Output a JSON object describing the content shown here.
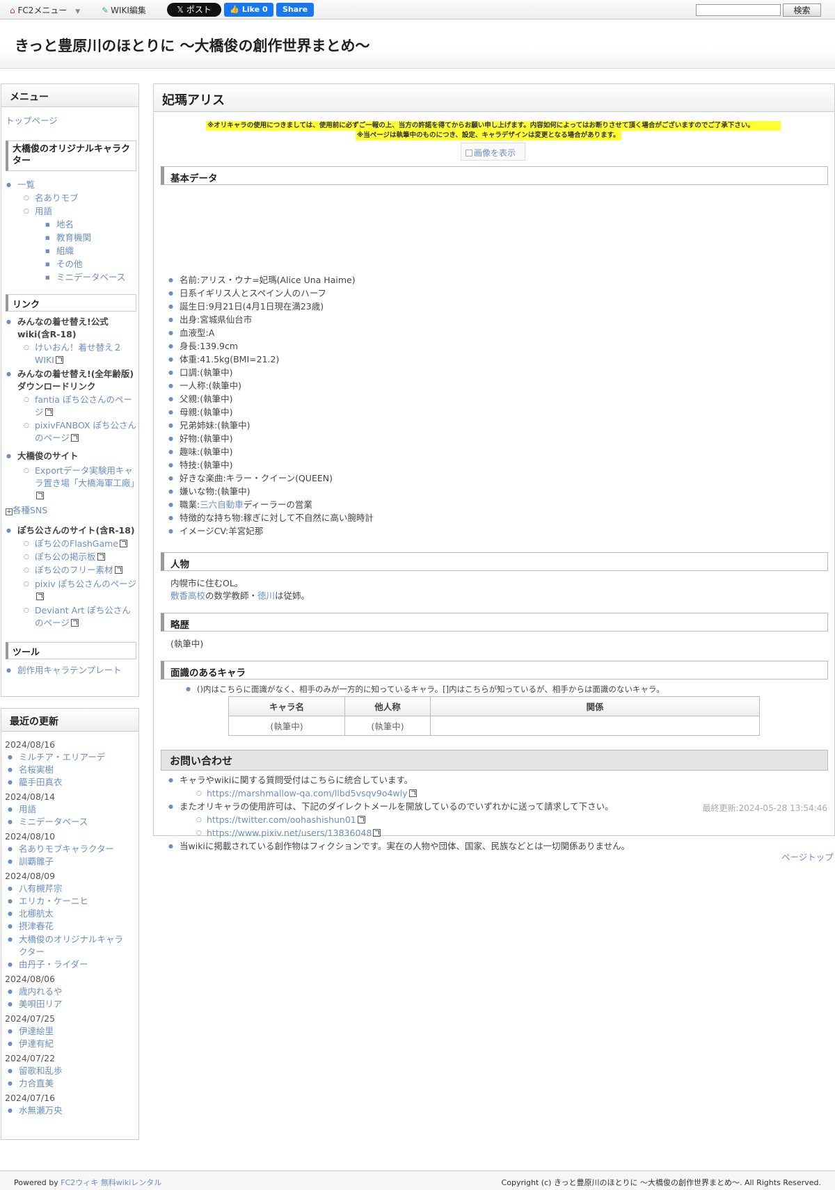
{
  "toolbar": {
    "fc2_menu": "FC2メニュー",
    "wiki_edit": "WIKI編集",
    "x_post": "𝕏 ポスト",
    "like": "Like 0",
    "share": "Share",
    "search_value": "",
    "search_button": "検索"
  },
  "site_title": "きっと豊原川のほとりに 〜大橋俊の創作世界まとめ〜",
  "menu": {
    "title": "メニュー",
    "top_page": "トップページ",
    "section_chars": "大橋俊のオリジナルキャラクター",
    "chars": {
      "list": "一覧",
      "named_mob": "名ありモブ",
      "terms": "用語",
      "place": "地名",
      "education": "教育機関",
      "org": "組織",
      "other": "その他",
      "mini_db": "ミニデータベース"
    },
    "section_links": "リンク",
    "links": {
      "kisekae_wiki": "みんなの着せ替え!公式wiki(含R-18)",
      "kon_wiki": "けいおん！着せ替え２WIKI",
      "kisekae_dl": "みんなの着せ替え!(全年齢版)ダウンロードリンク",
      "fantia": "fantia ぽち公さんのページ",
      "fanbox": "pixivFANBOX ぽち公さんのページ",
      "ohashi_site": "大橋俊のサイト",
      "export_site": "Exportデータ実験用キャラ置き場「大橋海軍工廠」",
      "sns": "各種SNS",
      "pochi_site": "ぽち公さんのサイト(含R-18)",
      "flash": "ぽち公のFlashGame",
      "bbs": "ぽち公の掲示板",
      "free": "ぽち公のフリー素材",
      "pixiv": "pixiv ぽち公さんのページ",
      "deviant": "Deviant Art ぽち公さんのページ"
    },
    "section_tools": "ツール",
    "tools": {
      "template": "創作用キャラテンプレート"
    }
  },
  "recent": {
    "title": "最近の更新",
    "groups": [
      {
        "date": "2024/08/16",
        "items": [
          "ミルチア・エリアーデ",
          "名桜実樹",
          "籠手田真衣"
        ]
      },
      {
        "date": "2024/08/14",
        "items": [
          "用語",
          "ミニデータベース"
        ]
      },
      {
        "date": "2024/08/10",
        "items": [
          "名ありモブキャラクター",
          "訓覇雛子"
        ]
      },
      {
        "date": "2024/08/09",
        "items": [
          "八有槻芹宗",
          "エリカ・ケーニヒ",
          "北梛航太",
          "摂津春花",
          "大橋俊のオリジナルキャラクター",
          "由丹子・ライダー"
        ]
      },
      {
        "date": "2024/08/06",
        "items": [
          "歳内れるや",
          "美唄田リア"
        ]
      },
      {
        "date": "2024/07/25",
        "items": [
          "伊達絵里",
          "伊達有紀"
        ]
      },
      {
        "date": "2024/07/22",
        "items": [
          "留歌和乱歩",
          "力合直美"
        ]
      },
      {
        "date": "2024/07/16",
        "items": [
          "水無瀬万央"
        ]
      }
    ]
  },
  "page": {
    "title": "妃瑪アリス",
    "notice1": "※オリキャラの使用につきましては、使用前に必ずご一報の上、当方の許諾を得てからお願い申し上げます。内容如何によってはお断りさせて頂く場合がございますのでご了承下さい。",
    "notice2": "※当ページは執筆中のものにつき、設定、キャラデザインは変更となる場合があります。",
    "image_link": "画像を表示",
    "sec_basic": "基本データ",
    "basic": [
      "名前:アリス・ウナ=妃瑪(Alice Una Haime)",
      "日系イギリス人とスペイン人のハーフ",
      "誕生日:9月21日(4月1日現在満23歳)",
      "出身:宮城県仙台市",
      "血液型:A",
      "身長:139.9cm",
      "体重:41.5kg(BMI=21.2)",
      "口調:(執筆中)",
      "一人称:(執筆中)",
      "父親:(執筆中)",
      "母親:(執筆中)",
      "兄弟姉妹:(執筆中)",
      "好物:(執筆中)",
      "趣味:(執筆中)",
      "特技:(執筆中)",
      "好きな楽曲:キラー・クイーン(QUEEN)"
    ],
    "basic_dislike": "嫌いな物:(執筆中)",
    "job_prefix": "職業:",
    "job_link": "三六自動車",
    "job_suffix": "ディーラーの営業",
    "feature": "特徴的な持ち物:稼ぎに対して不自然に高い腕時計",
    "image_cv": "イメージCV:羊宮妃那",
    "sec_person": "人物",
    "person_line1": "内幌市に住むOL。",
    "person_link1": "敷香高校",
    "person_mid": "の数学教師・",
    "person_link2": "徳川",
    "person_end": "は従姉。",
    "sec_history": "略歴",
    "history": "(執筆中)",
    "sec_acq": "面識のあるキャラ",
    "acq_note": "()内はこちらに面識がなく、相手のみが一方的に知っているキャラ。[]内はこちらが知っているが、相手からは面識のないキャラ。",
    "table": {
      "headers": [
        "キャラ名",
        "他人称",
        "関係"
      ],
      "row": [
        "(執筆中)",
        "(執筆中)",
        ""
      ]
    },
    "sec_contact": "お問い合わせ",
    "contact1": "キャラやwikiに関する質問受付はこちらに統合しています。",
    "contact1_link": "https://marshmallow-qa.com/llbd5vsqv9o4wly",
    "contact2": "またオリキャラの使用許可は、下記のダイレクトメールを開放しているのでいずれかに送って請求して下さい。",
    "contact2_link1": "https://twitter.com/oohashishun01",
    "contact2_link2": "https://www.pixiv.net/users/13836048",
    "contact3": "当wikiに掲載されている創作物はフィクションです。実在の人物や団体、国家、民族などとは一切関係ありません。",
    "last_modified": "最終更新:2024-05-28 13:54:46"
  },
  "page_top": "ページトップ",
  "footer": {
    "powered_prefix": "Powered by",
    "powered_link": "FC2ウィキ 無料wikiレンタル",
    "copyright": "Copyright (c) きっと豊原川のほとりに 〜大橋俊の創作世界まとめ〜. All Rights Reserved."
  }
}
